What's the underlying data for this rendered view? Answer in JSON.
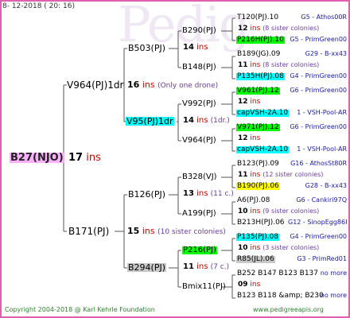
{
  "date": "8- 12-2018 ( 20: 16)",
  "watermark": "Pedig",
  "copyright": "Copyright 2004-2018 @ Karl Kehrle Foundation",
  "site": "www.pedigreeapis.org",
  "ins_label": "ins",
  "root": {
    "id": "B27(NJO)",
    "ins": "17",
    "color": "#ffb0ff"
  },
  "gen1": [
    {
      "id": "V964(PJ)1dr",
      "ins": "16",
      "note": "(Only one drone)"
    },
    {
      "id": "B171(PJ)",
      "ins": "15",
      "note": "(10 sister colonies)"
    }
  ],
  "gen2": [
    {
      "id": "B503(PJ)",
      "ins": "14",
      "note": ""
    },
    {
      "id": "V95(PJ)1dr",
      "ins": "14",
      "note": "(1dr.)",
      "color": "#00ffff"
    },
    {
      "id": "B126(PJ)",
      "ins": "13",
      "note": "(11 c.)"
    },
    {
      "id": "B294(PJ)",
      "ins": "11",
      "note": "(7 c.)",
      "color": "#c8c8c8"
    }
  ],
  "gen3": [
    {
      "id": "B290(PJ)"
    },
    {
      "id": "B148(PJ)"
    },
    {
      "id": "V992(PJ)"
    },
    {
      "id": "V964(PJ)"
    },
    {
      "id": "B328(VJ)"
    },
    {
      "id": "A199(PJ)"
    },
    {
      "id": "P216(PJ)",
      "color": "#00ff00"
    },
    {
      "id": "Bmix11(PJ)"
    }
  ],
  "gen4": [
    {
      "id": "T120(PJ).10",
      "info": "G5 - Athos00R"
    },
    {
      "ins": "12",
      "note": "(8 sister colonies)"
    },
    {
      "id": "P216H(PJ).10",
      "info": "G5 - PrimGreen00",
      "color": "#00ff00"
    },
    {
      "id": "B189(JG).09",
      "info": "G29 - B-xx43"
    },
    {
      "ins": "11",
      "note": "(8 sister colonies)"
    },
    {
      "id": "P135H(PJ).08",
      "info": "G4 - PrimGreen00",
      "color": "#00ffff"
    },
    {
      "id": "V961(PJ).12",
      "info": "G6 - PrimGreen00",
      "color": "#00ff00"
    },
    {
      "ins": "12",
      "note": ""
    },
    {
      "id": "capVSH-2A.10",
      "info": "1 - VSH-Pool-AR",
      "color": "#00ffff"
    },
    {
      "id": "V971(PJ).12",
      "info": "G6 - PrimGreen00",
      "color": "#00ff00"
    },
    {
      "ins": "12",
      "note": ""
    },
    {
      "id": "capVSH-2A.10",
      "info": "1 - VSH-Pool-AR",
      "color": "#00ffff"
    },
    {
      "id": "B123(PJ).09",
      "info": "G16 - AthosSt80R"
    },
    {
      "ins": "11",
      "note": "(12 sister colonies)"
    },
    {
      "id": "B190(PJ).06",
      "info": "G28 - B-xx43",
      "color": "#ffff00"
    },
    {
      "id": "A6(PJ).08",
      "info": "G6 - Cankiri97Q"
    },
    {
      "ins": "10",
      "note": "(9 sister colonies)"
    },
    {
      "id": "B213H(PJ).06",
      "info": "G12 - SinopEgg86R"
    },
    {
      "id": "P135(PJ).08",
      "info": "G4 - PrimGreen00",
      "color": "#00ffff"
    },
    {
      "ins": "10",
      "note": "(3 sister colonies)"
    },
    {
      "id": "R85(JL).06",
      "info": "G3 - PrimRed01",
      "color": "#c8c8c8"
    },
    {
      "id": "B252 B147 B123 B137",
      "info": "no more"
    },
    {
      "ins": "09",
      "note": ""
    },
    {
      "id": "B123 B118 &amp; B230",
      "info": "no more"
    }
  ]
}
